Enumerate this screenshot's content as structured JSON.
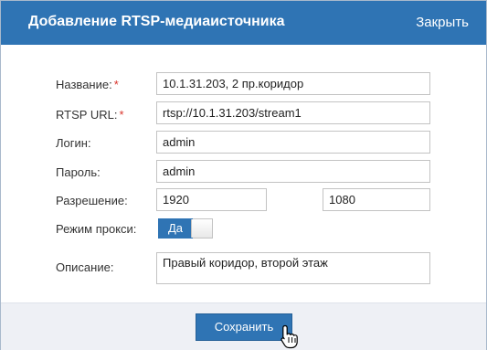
{
  "dialog": {
    "title": "Добавление RTSP-медиаисточника",
    "close_label": "Закрыть"
  },
  "form": {
    "name": {
      "label": "Название:",
      "required": "*",
      "value": "10.1.31.203, 2 пр.коридор"
    },
    "rtsp_url": {
      "label": "RTSP URL:",
      "required": "*",
      "value": "rtsp://10.1.31.203/stream1"
    },
    "login": {
      "label": "Логин:",
      "value": "admin"
    },
    "password": {
      "label": "Пароль:",
      "value": "admin"
    },
    "resolution": {
      "label": "Разрешение:",
      "width": "1920",
      "height": "1080"
    },
    "proxy": {
      "label": "Режим прокси:",
      "toggle_text": "Да",
      "enabled": true
    },
    "description": {
      "label": "Описание:",
      "value": "Правый коридор, второй этаж"
    }
  },
  "footer": {
    "save_label": "Сохранить"
  },
  "colors": {
    "accent": "#2f74b4",
    "required": "#d9342b",
    "footer_bg": "#eef0f5"
  },
  "icons": {
    "cursor": "hand-pointer-icon"
  }
}
